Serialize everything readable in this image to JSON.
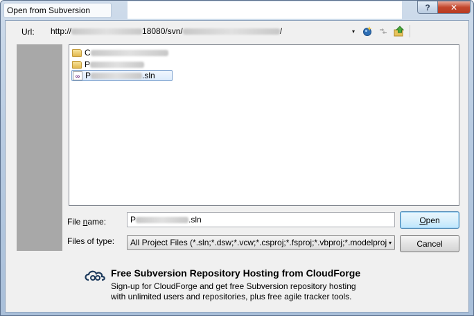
{
  "window": {
    "title": "Open from Subversion",
    "help_label": "?",
    "close_label": "✕"
  },
  "url": {
    "label": "Url:",
    "prefix": "http://",
    "port_path": "18080/svn/",
    "suffix": "/",
    "dropdown_glyph": "▾"
  },
  "toolbar": {
    "icons": [
      "new-repository-icon",
      "refresh-icon",
      "up-folder-icon"
    ]
  },
  "files": [
    {
      "name_visible": "C",
      "tail": "",
      "type": "folder"
    },
    {
      "name_visible": "P",
      "tail": "",
      "type": "folder"
    },
    {
      "name_visible": "P",
      "tail": ".sln",
      "type": "solution",
      "selected": true
    }
  ],
  "file_name": {
    "label_before": "File ",
    "label_underline": "n",
    "label_after": "ame:",
    "value_visible": "P",
    "value_tail": ".sln"
  },
  "file_type": {
    "label": "Files of type:",
    "value": "All Project Files (*.sln;*.dsw;*.vcw;*.csproj;*.fsproj;*.vbproj;*.modelproj",
    "arrow": "▾"
  },
  "buttons": {
    "open_underline": "O",
    "open_rest": "pen",
    "cancel": "Cancel"
  },
  "promo": {
    "title": "Free Subversion Repository Hosting from CloudForge",
    "line1": "Sign-up for CloudForge and get free Subversion repository hosting",
    "line2": "with unlimited users and repositories, plus free agile tracker tools."
  },
  "colors": {
    "title_gradient_top": "#cfdceb",
    "close_red": "#c3472d",
    "sidebar_gray": "#a8a8a8",
    "selection_border": "#7da2ce",
    "default_button_border": "#3c7fb1"
  }
}
